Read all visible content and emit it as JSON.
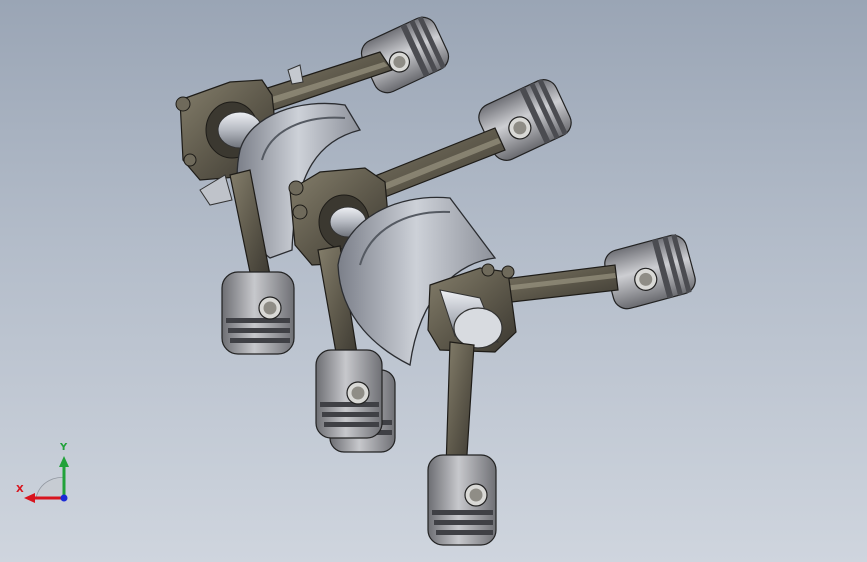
{
  "viewport": {
    "background_top": "#9aa5b5",
    "background_bottom": "#cfd5de"
  },
  "model": {
    "parts": [
      "crankshaft",
      "connecting-rod",
      "piston"
    ],
    "colors": {
      "rod_metal": "#5f5a4c",
      "piston_metal": "#a6a7ab",
      "crank_metal": "#b2b6bf"
    }
  },
  "triad": {
    "x_label": "X",
    "y_label": "Y",
    "x_color": "#d8141e",
    "y_color": "#21a23a",
    "z_color": "#1b2bd6"
  }
}
